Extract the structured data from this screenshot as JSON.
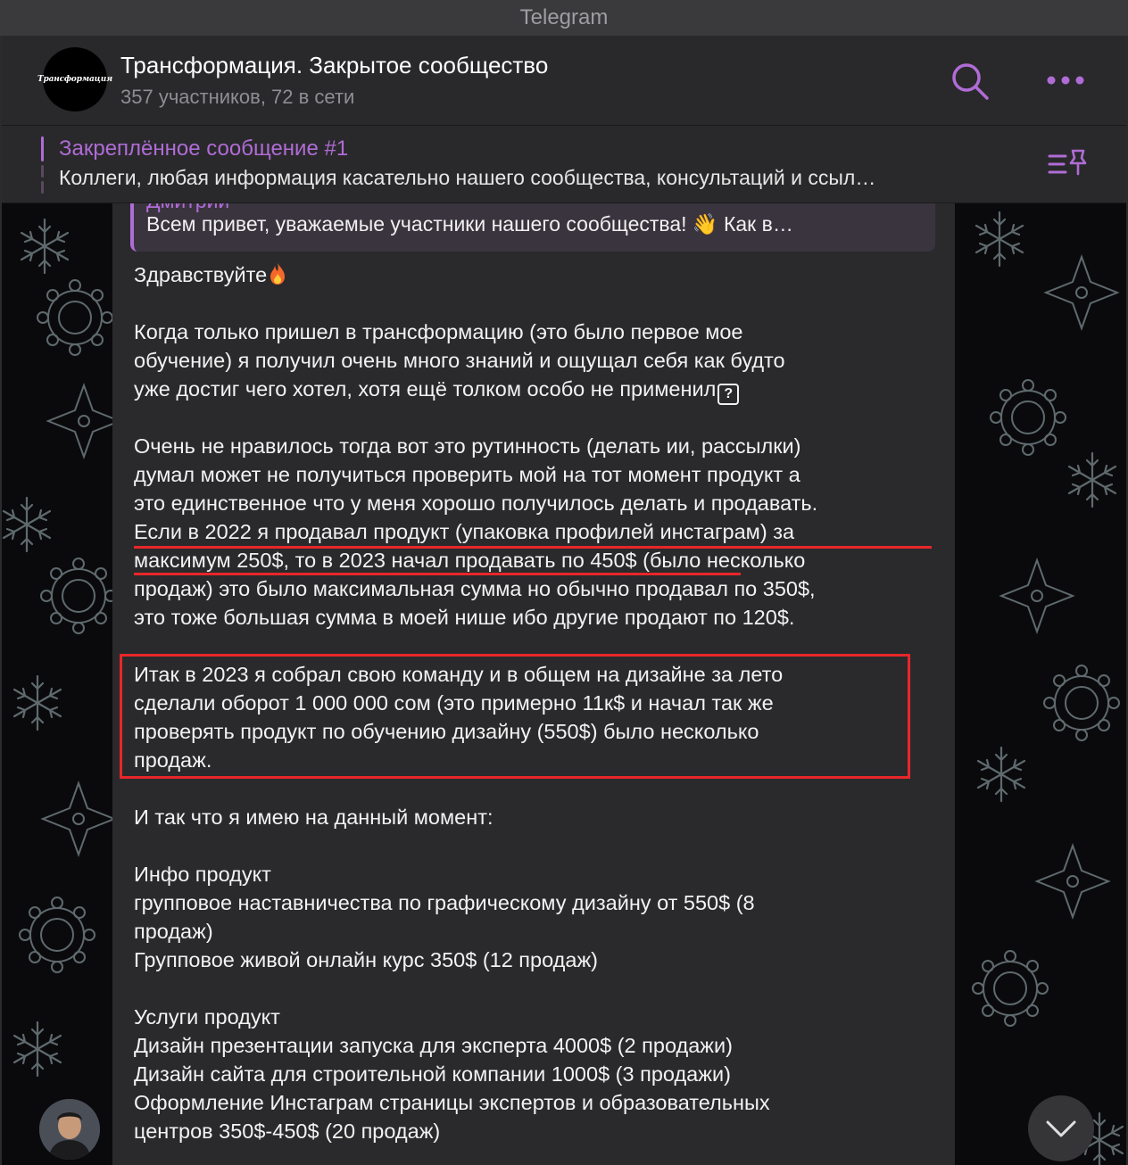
{
  "window": {
    "title": "Telegram"
  },
  "header": {
    "avatar_logo": "Трансформация",
    "title": "Трансформация. Закрытое сообщество",
    "subtitle": "357 участников, 72 в сети",
    "search_icon": "search-icon",
    "more_icon": "more-horizontal-icon"
  },
  "pinned": {
    "title": "Закреплённое сообщение #1",
    "text": "Коллеги, любая информация касательно нашего сообщества, консультаций и ссыл…",
    "list_icon": "pinned-list-icon"
  },
  "reply": {
    "author": "Дмитрий",
    "text": "Всем привет, уважаемые участники нашего сообщества! 👋 Как в…"
  },
  "message": {
    "greeting": "Здравствуйте",
    "lines": [
      "Когда только пришел в трансформацию (это было первое мое",
      "обучение) я получил очень много знаний и ощущал себя как будто",
      "уже достиг чего хотел, хотя ещё толком особо не применил",
      "Очень не нравилось тогда вот это рутинность (делать ии, рассылки)",
      "думал может не получиться проверить мой на тот момент продукт а",
      "это единственное что у меня хорошо получилось делать и продавать.",
      "Если в 2022 я продавал продукт (упаковка профилей инстаграм) за",
      "максимум 250$, то в 2023 начал продавать по 450$ (было несколько",
      "продаж) это было максимальная сумма но обычно продавал по 350$,",
      "это  тоже большая сумма в моей нише ибо другие продают по 120$.",
      "Итак в 2023 я собрал свою команду и в общем на дизайне за лето",
      "сделали оборот 1 000 000 сом (это примерно 11к$ и начал так же",
      "проверять продукт по обучению дизайну (550$) было несколько",
      "продаж.",
      "И так что я имею на данный момент:",
      "Инфо продукт",
      "групповое наставничества по графическому дизайну от 550$ (8",
      "продаж)",
      "Групповое живой онлайн курс 350$ (12 продаж)",
      "Услуги продукт",
      "Дизайн презентации запуска для эксперта 4000$ (2 продажи)",
      "Дизайн сайта для строительной компании 1000$ (3 продажи)",
      "Оформление Инстаграм страницы экспертов и образовательных",
      "центров 350$-450$ (20 продаж)"
    ]
  },
  "controls": {
    "scroll_down_icon": "chevron-down-icon"
  },
  "colors": {
    "accent": "#b06cd6",
    "highlight": "#e8262a",
    "bubble": "#2a2a2c",
    "header": "#29292b"
  }
}
